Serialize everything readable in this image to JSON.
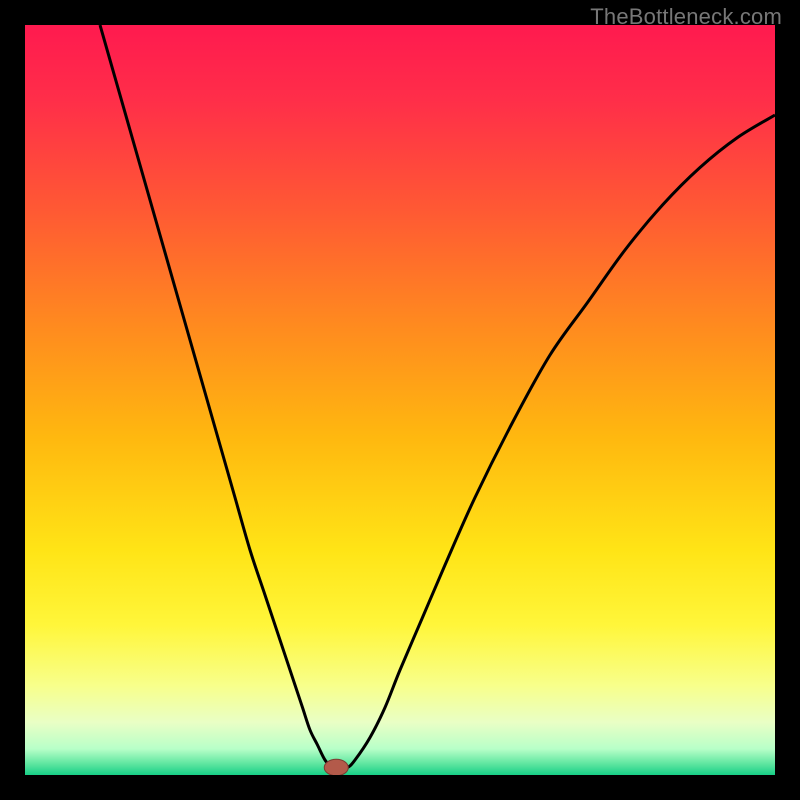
{
  "watermark": "TheBottleneck.com",
  "colors": {
    "frame_bg": "#000000",
    "gradient_stops": [
      {
        "offset": 0.0,
        "color": "#ff1a4f"
      },
      {
        "offset": 0.1,
        "color": "#ff2e49"
      },
      {
        "offset": 0.25,
        "color": "#ff5a33"
      },
      {
        "offset": 0.4,
        "color": "#ff8a1f"
      },
      {
        "offset": 0.55,
        "color": "#ffb80f"
      },
      {
        "offset": 0.7,
        "color": "#ffe416"
      },
      {
        "offset": 0.8,
        "color": "#fff63a"
      },
      {
        "offset": 0.88,
        "color": "#f8ff8a"
      },
      {
        "offset": 0.93,
        "color": "#e9ffc5"
      },
      {
        "offset": 0.965,
        "color": "#b8ffc8"
      },
      {
        "offset": 0.985,
        "color": "#5fe6a0"
      },
      {
        "offset": 1.0,
        "color": "#17cf87"
      }
    ],
    "curve": "#000000",
    "marker_fill": "#b35a4a",
    "marker_stroke": "#7a3c32"
  },
  "chart_data": {
    "type": "line",
    "title": "",
    "xlabel": "",
    "ylabel": "",
    "xlim": [
      0,
      100
    ],
    "ylim": [
      0,
      100
    ],
    "grid": false,
    "series": [
      {
        "name": "bottleneck-curve",
        "x": [
          10,
          12,
          14,
          16,
          18,
          20,
          22,
          24,
          26,
          28,
          30,
          32,
          34,
          36,
          37,
          38,
          39,
          40,
          41,
          42,
          43,
          44,
          46,
          48,
          50,
          53,
          56,
          60,
          65,
          70,
          75,
          80,
          85,
          90,
          95,
          100
        ],
        "y": [
          100,
          93,
          86,
          79,
          72,
          65,
          58,
          51,
          44,
          37,
          30,
          24,
          18,
          12,
          9,
          6,
          4,
          2,
          1,
          1,
          1,
          2,
          5,
          9,
          14,
          21,
          28,
          37,
          47,
          56,
          63,
          70,
          76,
          81,
          85,
          88
        ]
      }
    ],
    "marker": {
      "x": 41.5,
      "y": 1,
      "rx": 1.6,
      "ry": 1.1
    }
  }
}
